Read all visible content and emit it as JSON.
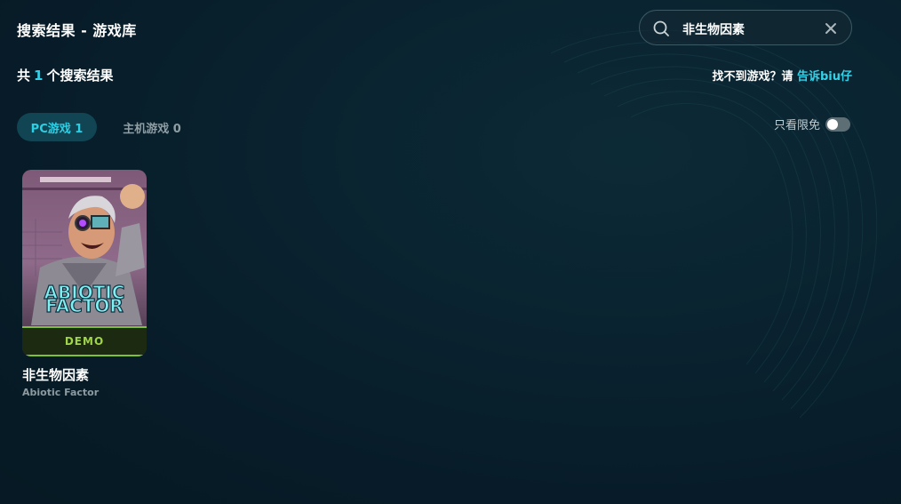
{
  "header": {
    "title": "搜索结果 - 游戏库"
  },
  "search": {
    "query": "非生物因素"
  },
  "results": {
    "prefix": "共",
    "count": "1",
    "suffix": "个搜索结果"
  },
  "feedback": {
    "text": "找不到游戏？请 ",
    "link": "告诉biu仔"
  },
  "tabs": [
    {
      "label": "PC游戏 1",
      "active": true
    },
    {
      "label": "主机游戏 0",
      "active": false
    }
  ],
  "filter": {
    "limited_only_label": "只看限免",
    "enabled": false
  },
  "games": [
    {
      "title": "非生物因素",
      "subtitle": "Abiotic Factor",
      "cover_logo_line1": "ABIOTIC",
      "cover_logo_line2": "FACTOR",
      "badge": "DEMO"
    }
  ],
  "colors": {
    "accent": "#33d1e8",
    "tab_active_bg": "#114553",
    "demo_green": "#9fd44b"
  }
}
